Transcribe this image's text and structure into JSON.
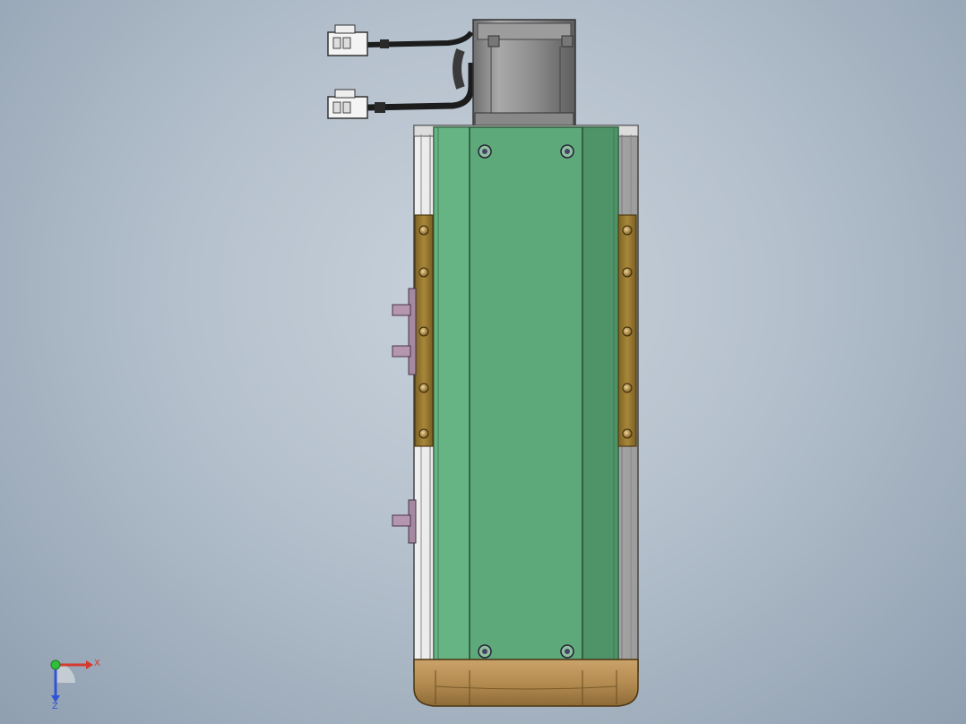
{
  "viewport": {
    "background_center": "#c9d2dc",
    "background_edge": "#8f9fb0"
  },
  "model": {
    "carriage_color": "#5ea97a",
    "rail_color": "#c9c9c9",
    "motor_color": "#8f8f8f",
    "end_cap_color": "#b58f4f",
    "side_strip_color": "#9a7a2c",
    "bracket_color": "#9a6f8f"
  },
  "triad": {
    "x_label": "X",
    "z_label": "Z",
    "x_color": "#d43a2f",
    "y_color": "#2fbf3a",
    "z_color": "#2f55d4"
  }
}
